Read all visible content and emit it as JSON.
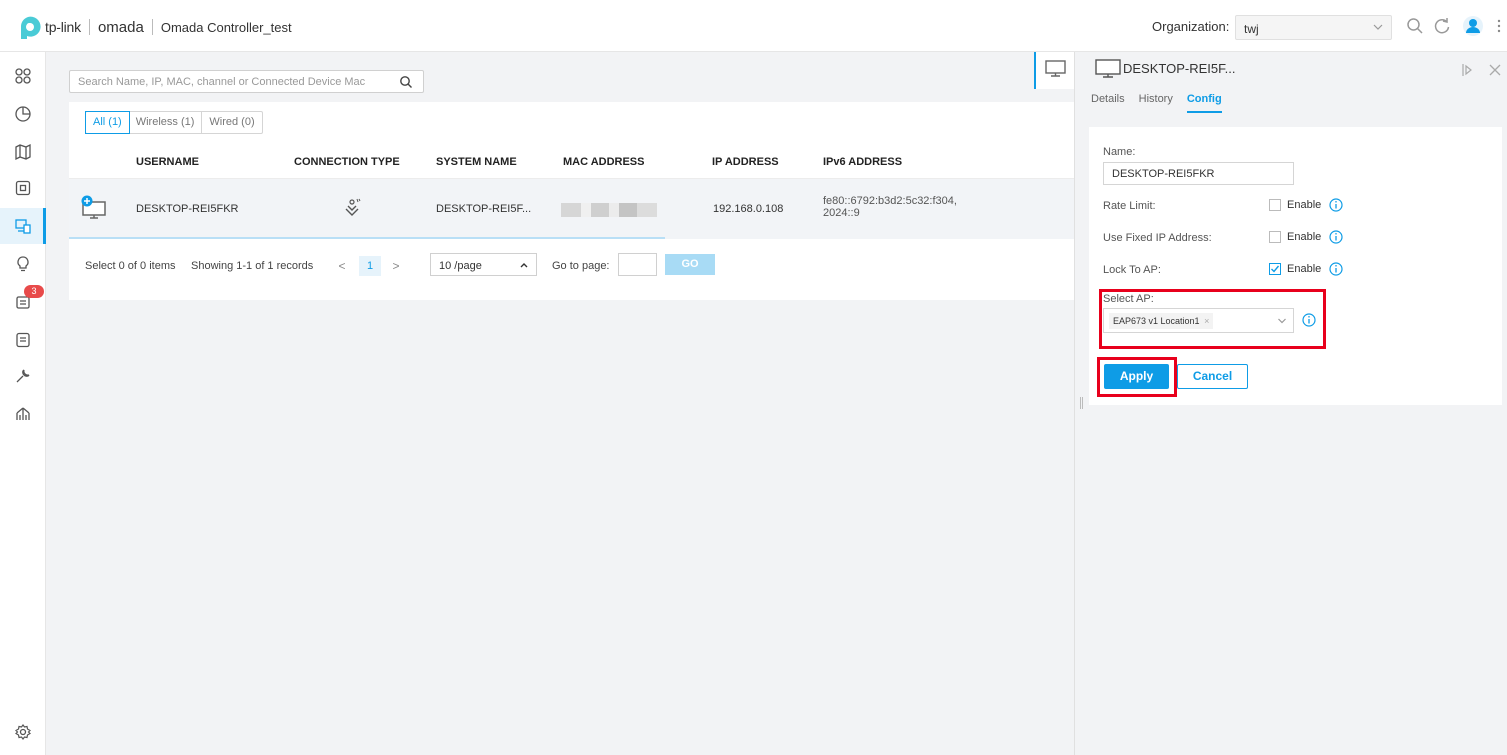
{
  "header": {
    "brand_tplink": "tp-link",
    "brand_omada": "omada",
    "site_title": "Omada Controller_test",
    "org_label": "Organization:",
    "org_value": "twj"
  },
  "nav": {
    "alerts_badge": "3"
  },
  "search": {
    "placeholder": "Search Name, IP, MAC, channel or Connected Device Mac"
  },
  "filters": {
    "all": "All (1)",
    "wireless": "Wireless (1)",
    "wired": "Wired (0)"
  },
  "table": {
    "columns": [
      "USERNAME",
      "CONNECTION TYPE",
      "SYSTEM NAME",
      "MAC ADDRESS",
      "IP ADDRESS",
      "IPv6 ADDRESS"
    ],
    "rows": [
      {
        "username": "DESKTOP-REI5FKR",
        "system_name": "DESKTOP-REI5F...",
        "ip": "192.168.0.108",
        "ipv6_line1": "fe80::6792:b3d2:5c32:f304,",
        "ipv6_line2": "2024::9"
      }
    ]
  },
  "pager": {
    "selected": "Select 0 of 0 items",
    "showing": "Showing 1-1 of 1 records",
    "prev": "<",
    "page": "1",
    "next": ">",
    "page_size": "10 /page",
    "goto_label": "Go to page:",
    "go": "GO"
  },
  "panel": {
    "title": "DESKTOP-REI5F...",
    "tabs": [
      "Details",
      "History",
      "Config"
    ],
    "name_label": "Name:",
    "name_value": "DESKTOP-REI5FKR",
    "rate_limit_label": "Rate Limit:",
    "fixed_ip_label": "Use Fixed IP Address:",
    "lock_ap_label": "Lock To AP:",
    "enable": "Enable",
    "select_ap_label": "Select AP:",
    "selected_ap": "EAP673 v1 Location1",
    "tag_remove": "×",
    "apply": "Apply",
    "cancel": "Cancel"
  },
  "colors": {
    "accent": "#0e9ce6",
    "highlight_box": "#e8001c",
    "badge": "#e84a4a"
  }
}
